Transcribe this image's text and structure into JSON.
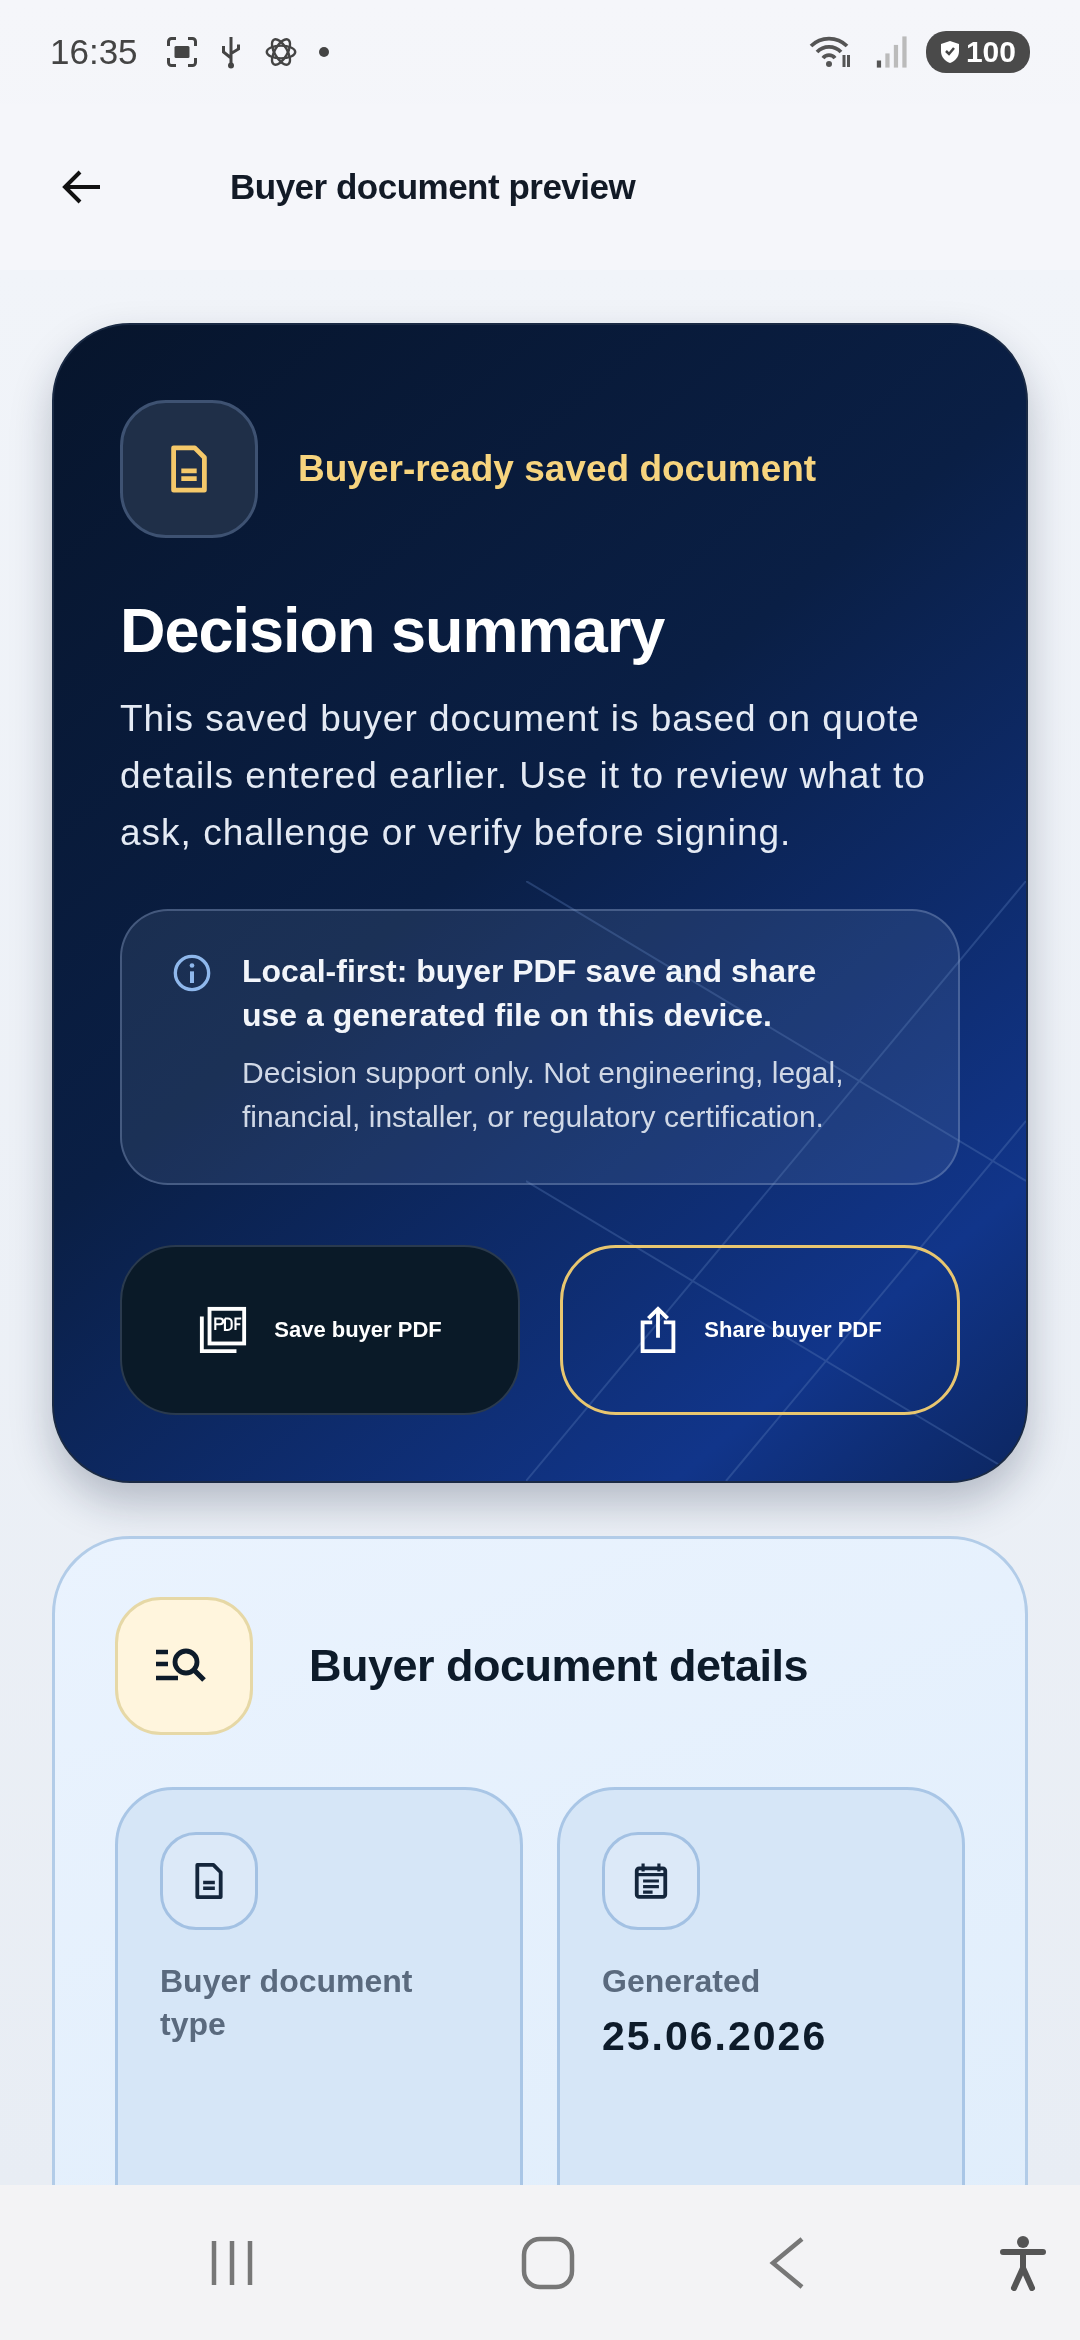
{
  "status_bar": {
    "time": "16:35",
    "battery": "100"
  },
  "app_bar": {
    "title": "Buyer document preview"
  },
  "summary_card": {
    "badge": "Buyer-ready saved document",
    "title": "Decision summary",
    "body": "This saved buyer document is based on quote details entered earlier. Use it to review what to ask, challenge or verify before signing.",
    "notice": {
      "title": "Local-first: buyer PDF save and share use a generated file on this device.",
      "text": "Decision support only. Not engineering, legal, financial, installer, or regulatory certification."
    },
    "buttons": [
      {
        "label": "Save buyer PDF",
        "kind": "save",
        "outlined": false
      },
      {
        "label": "Share buyer PDF",
        "kind": "share",
        "outlined": true
      }
    ]
  },
  "details_card": {
    "title": "Buyer document details",
    "tiles": [
      {
        "kind": "document",
        "label": "Buyer document type"
      },
      {
        "kind": "calendar",
        "label": "Generated",
        "value": "25.06.2026"
      }
    ]
  }
}
